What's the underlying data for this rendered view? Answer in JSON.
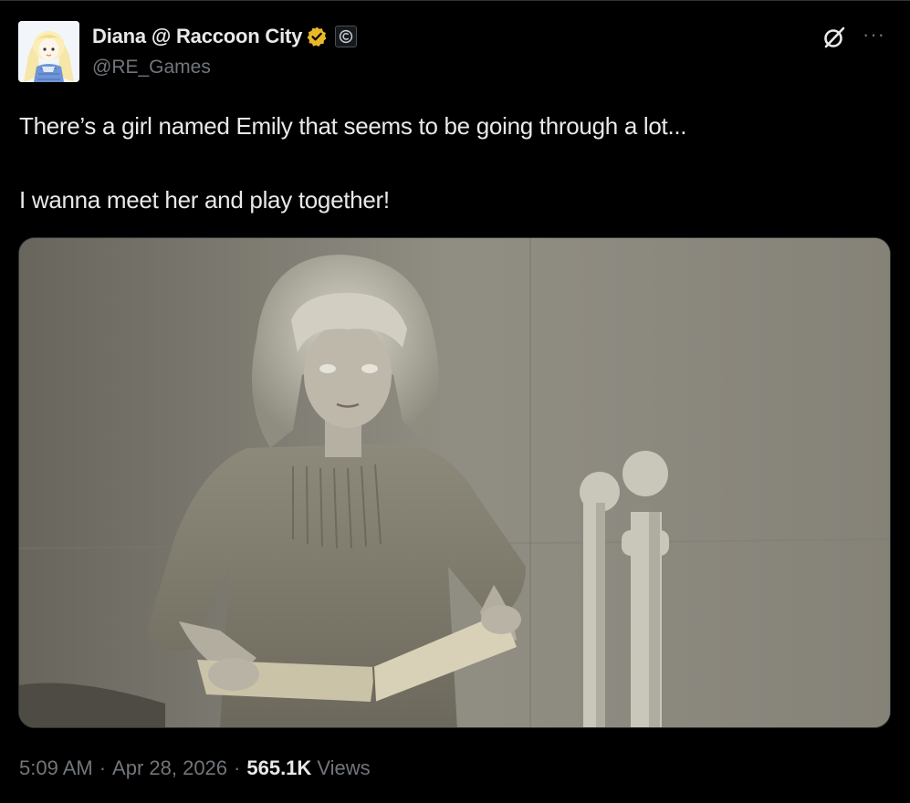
{
  "post": {
    "author": {
      "display_name": "Diana @ Raccoon City",
      "handle": "@RE_Games",
      "avatar_icon": "anime-girl-avatar",
      "verified_color": "#e8b82a"
    },
    "text_lines": [
      "There’s a girl named Emily that seems to be going through a lot...",
      "I wanna meet her and play together!"
    ],
    "media": {
      "icon": "photo-girl-with-book"
    },
    "meta": {
      "time": "5:09 AM",
      "separator": "·",
      "date": "Apr 28, 2026",
      "views_count": "565.1K",
      "views_label": "Views"
    }
  },
  "colors": {
    "background": "#000000",
    "primary_text": "#e7e9ea",
    "secondary_text": "#71767b",
    "border": "#2f3336"
  }
}
